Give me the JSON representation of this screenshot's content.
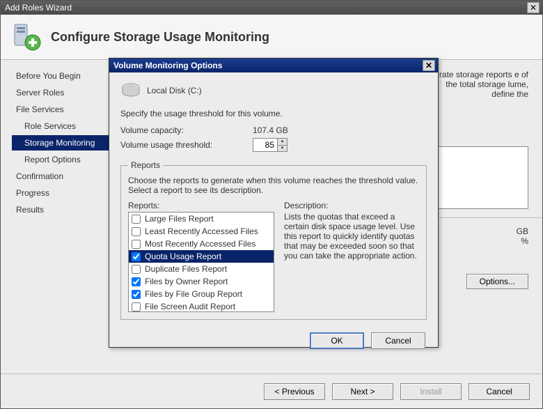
{
  "wizard": {
    "title": "Add Roles Wizard",
    "header": "Configure Storage Usage Monitoring",
    "nav": {
      "items": [
        {
          "label": "Before You Begin",
          "sub": false,
          "sel": false
        },
        {
          "label": "Server Roles",
          "sub": false,
          "sel": false
        },
        {
          "label": "File Services",
          "sub": false,
          "sel": false
        },
        {
          "label": "Role Services",
          "sub": true,
          "sel": false
        },
        {
          "label": "Storage Monitoring",
          "sub": true,
          "sel": true
        },
        {
          "label": "Report Options",
          "sub": true,
          "sel": false
        },
        {
          "label": "Confirmation",
          "sub": false,
          "sel": false
        },
        {
          "label": "Progress",
          "sub": false,
          "sel": false
        },
        {
          "label": "Results",
          "sub": false,
          "sel": false
        }
      ]
    },
    "content": {
      "intro_tail": "rate storage reports e of the total storage lume, define the",
      "vol_threshold_lbl": "Volume usage threshold:",
      "vol_threshold_val": "GB",
      "vol_threshold_pct": "%",
      "options_btn": "Options..."
    },
    "footer": {
      "previous": "< Previous",
      "next": "Next >",
      "install": "Install",
      "cancel": "Cancel"
    }
  },
  "modal": {
    "title": "Volume Monitoring Options",
    "disk_label": "Local Disk (C:)",
    "spec": "Specify the usage threshold for this volume.",
    "capacity_lbl": "Volume capacity:",
    "capacity_val": "107.4 GB",
    "threshold_lbl": "Volume usage threshold:",
    "threshold_val": "85",
    "reports_legend": "Reports",
    "reports_intro": "Choose the reports to generate when this volume reaches the threshold value. Select a report to see its description.",
    "reports_label": "Reports:",
    "desc_label": "Description:",
    "desc_text": "Lists the quotas that exceed a certain disk space usage level. Use this report to quickly identify quotas that may be exceeded soon so that you can take the appropriate action.",
    "report_items": [
      {
        "label": "Large Files Report",
        "checked": false,
        "sel": false
      },
      {
        "label": "Least Recently Accessed Files",
        "checked": false,
        "sel": false
      },
      {
        "label": "Most Recently Accessed Files",
        "checked": false,
        "sel": false
      },
      {
        "label": "Quota Usage Report",
        "checked": true,
        "sel": true
      },
      {
        "label": "Duplicate Files Report",
        "checked": false,
        "sel": false
      },
      {
        "label": "Files by Owner Report",
        "checked": true,
        "sel": false
      },
      {
        "label": "Files by File Group Report",
        "checked": true,
        "sel": false
      },
      {
        "label": "File Screen Audit Report",
        "checked": false,
        "sel": false
      }
    ],
    "ok": "OK",
    "cancel": "Cancel"
  }
}
